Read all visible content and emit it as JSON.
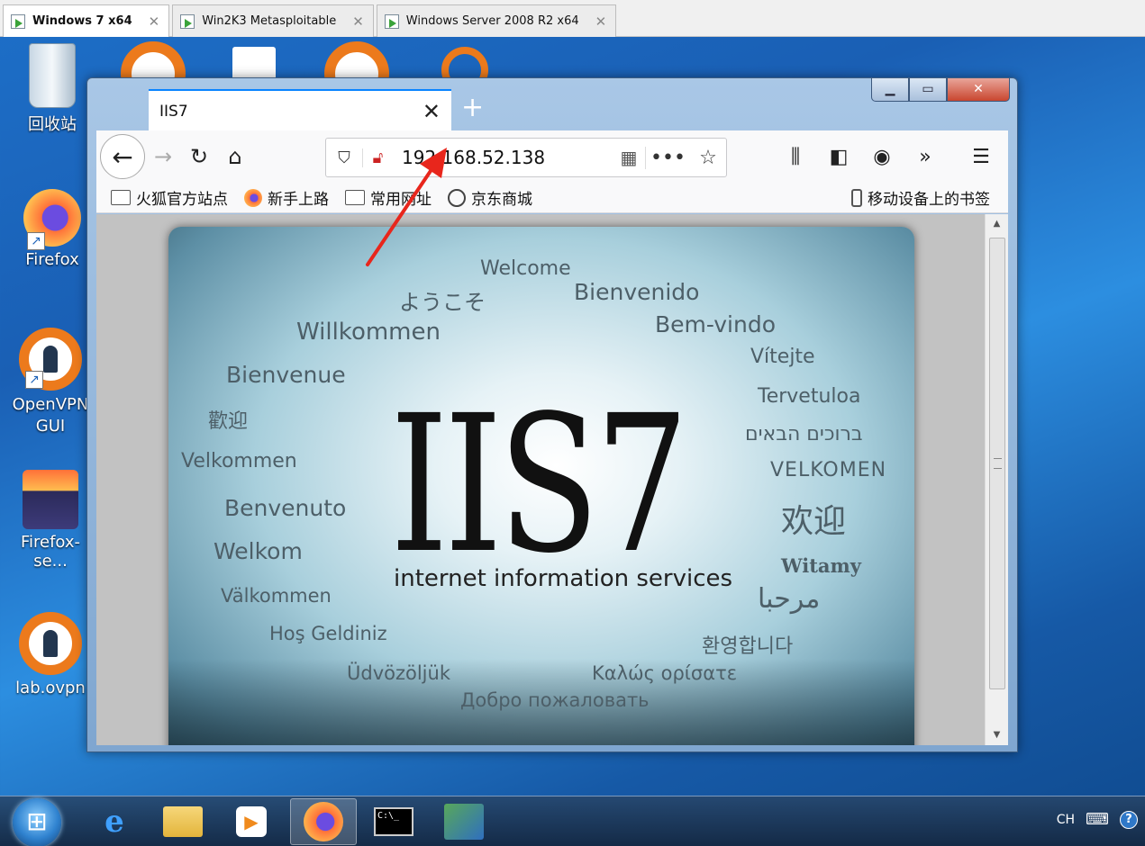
{
  "vm_tabs": [
    {
      "label": "Windows 7 x64"
    },
    {
      "label": "Win2K3 Metasploitable"
    },
    {
      "label": "Windows Server 2008 R2 x64"
    }
  ],
  "desktop_icons": {
    "recycle": "回收站",
    "firefox": "Firefox",
    "openvpn": "OpenVPN GUI",
    "firefox_se": "Firefox-se...",
    "lab_ovpn": "lab.ovpn"
  },
  "browser": {
    "tab_title": "IIS7",
    "url": "192.168.52.138",
    "bookmarks": [
      "火狐官方站点",
      "新手上路",
      "常用网址",
      "京东商城"
    ],
    "mobile_bookmarks": "移动设备上的书签"
  },
  "iis_page": {
    "logo": "IIS7",
    "tagline": "internet information services",
    "greetings": {
      "welcome": "Welcome",
      "yokoso": "ようこそ",
      "bienvenido": "Bienvenido",
      "bemvindo": "Bem-vindo",
      "willkommen": "Willkommen",
      "vitejte": "Vítejte",
      "bienvenue": "Bienvenue",
      "tervetuloa": "Tervetuloa",
      "huanying_tw": "歡迎",
      "hebrew": "ברוכים הבאים",
      "velkommen": "Velkommen",
      "velkomen": "VELKOMEN",
      "benvenuto": "Benvenuto",
      "huanying_cn": "欢迎",
      "welkom": "Welkom",
      "witamy": "Witamy",
      "valkommen": "Välkommen",
      "arabic": "مرحبا",
      "hos_geldiniz": "Hoş Geldiniz",
      "korean": "환영합니다",
      "udvozoljuk": "Üdvözöljük",
      "greek": "Καλώς ορίσατε",
      "russian": "Добро пожаловать"
    }
  },
  "tray": {
    "lang": "CH",
    "help": "?"
  }
}
